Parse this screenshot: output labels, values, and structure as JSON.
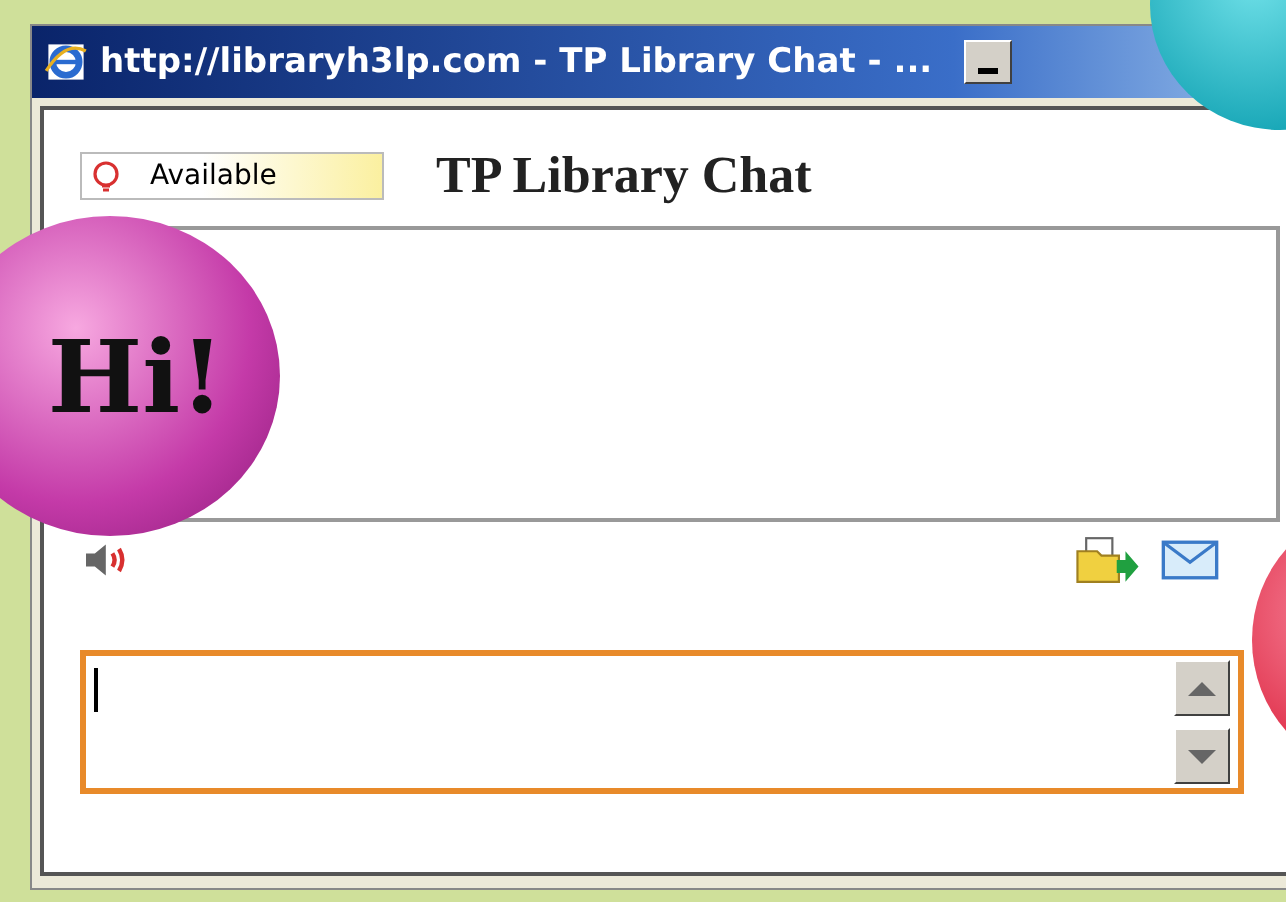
{
  "window": {
    "title": "http://libraryh3lp.com - TP Library Chat - ..."
  },
  "status": {
    "label": "Available"
  },
  "chat_title": "TP Library Chat",
  "bubble": {
    "text": "Hi!"
  }
}
